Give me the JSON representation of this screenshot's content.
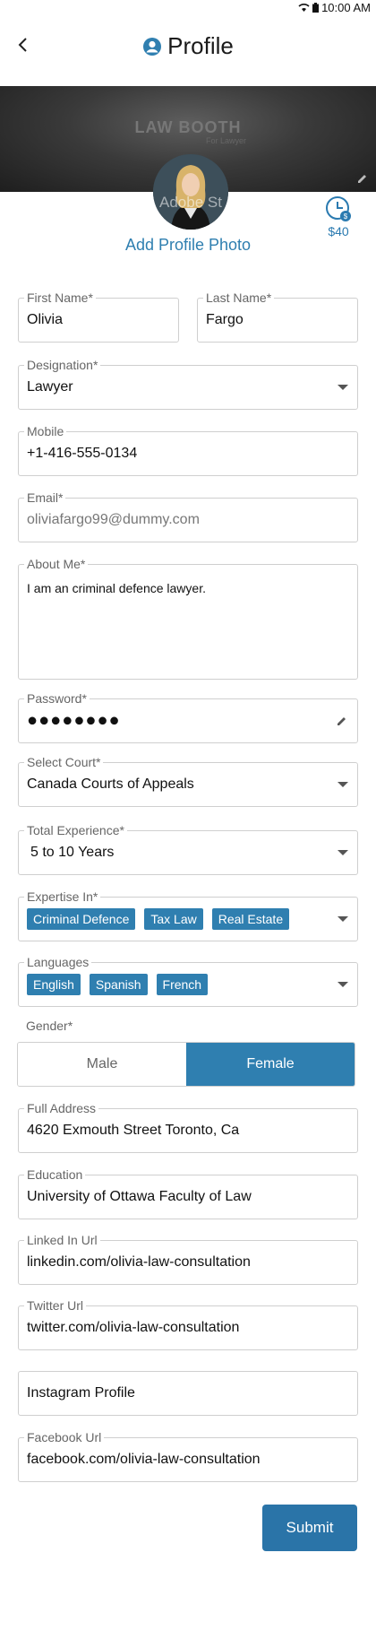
{
  "status_bar": {
    "time": "10:00 AM"
  },
  "header": {
    "title": "Profile"
  },
  "cover": {
    "brand": "LAW BOOTH",
    "brand_sub": "For Lawyer"
  },
  "avatar": {
    "overlay_text": "Adobe St"
  },
  "coins": {
    "amount": "$40"
  },
  "add_photo_label": "Add Profile Photo",
  "fields": {
    "first_name": {
      "label": "First Name*",
      "value": "Olivia"
    },
    "last_name": {
      "label": "Last Name*",
      "value": "Fargo"
    },
    "designation": {
      "label": "Designation*",
      "value": "Lawyer"
    },
    "mobile": {
      "label": "Mobile",
      "value": "+1-416-555-0134"
    },
    "email": {
      "label": "Email*",
      "value": "oliviafargo99@dummy.com"
    },
    "about": {
      "label": "About Me*",
      "value": "I am an criminal defence lawyer."
    },
    "password": {
      "label": "Password*",
      "value": "●●●●●●●●"
    },
    "court": {
      "label": "Select Court*",
      "value": "Canada Courts of Appeals"
    },
    "experience": {
      "label": "Total Experience*",
      "value": "5 to 10 Years"
    },
    "expertise": {
      "label": "Expertise In*",
      "chips": [
        "Criminal Defence",
        "Tax Law",
        "Real Estate"
      ]
    },
    "languages": {
      "label": "Languages",
      "chips": [
        "English",
        "Spanish",
        "French"
      ]
    },
    "address": {
      "label": "Full Address",
      "value": "4620  Exmouth Street Toronto, Ca"
    },
    "education": {
      "label": "Education",
      "value": "University of Ottawa Faculty of Law"
    },
    "linkedin": {
      "label": "Linked In Url",
      "value": "linkedin.com/olivia-law-consultation"
    },
    "twitter": {
      "label": "Twitter Url",
      "value": "twitter.com/olivia-law-consultation"
    },
    "instagram": {
      "placeholder": "Instagram Profile"
    },
    "facebook": {
      "label": "Facebook Url",
      "value": "facebook.com/olivia-law-consultation"
    }
  },
  "gender": {
    "label": "Gender*",
    "options": [
      "Male",
      "Female"
    ],
    "selected": "Female"
  },
  "submit_label": "Submit",
  "colors": {
    "accent": "#2f7fb0",
    "border": "#cfcfcf"
  }
}
